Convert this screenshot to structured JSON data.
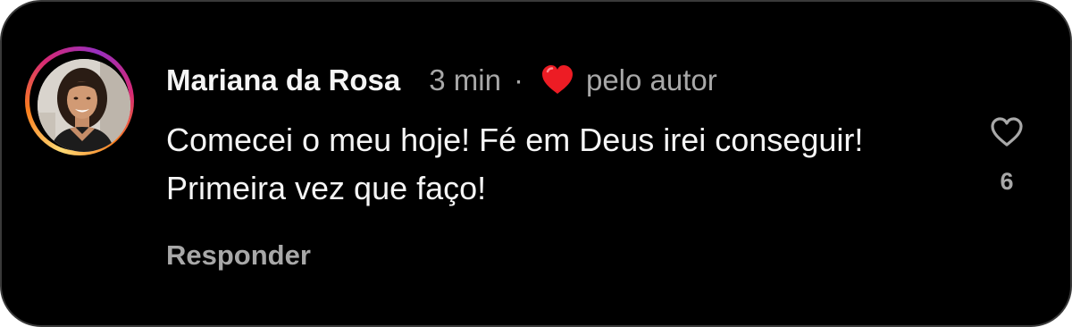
{
  "comment": {
    "author": "Mariana da Rosa",
    "time": "3 min",
    "separator": "·",
    "liked_by_author_label": "pelo autor",
    "text": "Comecei o meu hoje! Fé em Deus irei conseguir! Primeira vez que faço!",
    "reply_label": "Responder",
    "like_count": "6"
  },
  "icons": {
    "avatar": "profile-photo",
    "author_like": "red-heart-icon",
    "like_button": "heart-outline-icon"
  },
  "colors": {
    "background": "#000000",
    "primary_text": "#f5f5f5",
    "secondary_text": "#a8a8a8",
    "heart_red": "#ed1c24"
  }
}
